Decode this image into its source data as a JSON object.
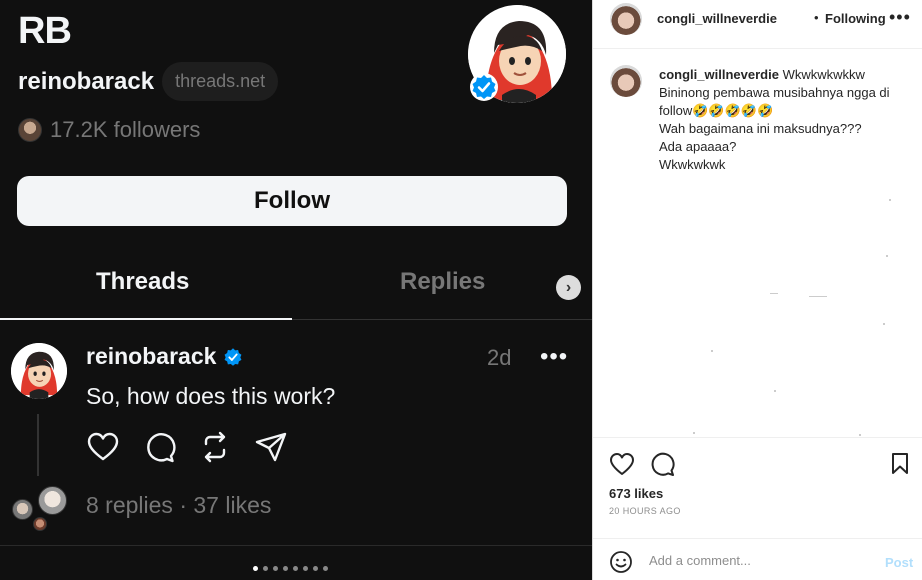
{
  "threads": {
    "initials": "RB",
    "username": "reinobarack",
    "domain": "threads.net",
    "followers": "17.2K followers",
    "follow_label": "Follow",
    "tabs": [
      "Threads",
      "Replies"
    ],
    "post": {
      "username": "reinobarack",
      "time": "2d",
      "text": "So, how does this work?",
      "stats": "8 replies · 37 likes"
    }
  },
  "instagram": {
    "header_user": "congli_willneverdie",
    "header_dot": "•",
    "following": "Following",
    "caption_user": "congli_willneverdie",
    "caption_lines": [
      "Wkwkwkwkkw",
      "Bininong pembawa musibahnya ngga di follow🤣🤣🤣🤣🤣",
      "Wah bagaimana ini maksudnya???",
      "Ada apaaaa?",
      "Wkwkwkwk"
    ],
    "likes": "673 likes",
    "time_ago": "20 HOURS AGO",
    "comment_placeholder": "Add a comment...",
    "post_label": "Post"
  },
  "colors": {
    "threads_bg": "#101010",
    "verified_blue": "#0095f6",
    "muted_text": "#777777"
  }
}
